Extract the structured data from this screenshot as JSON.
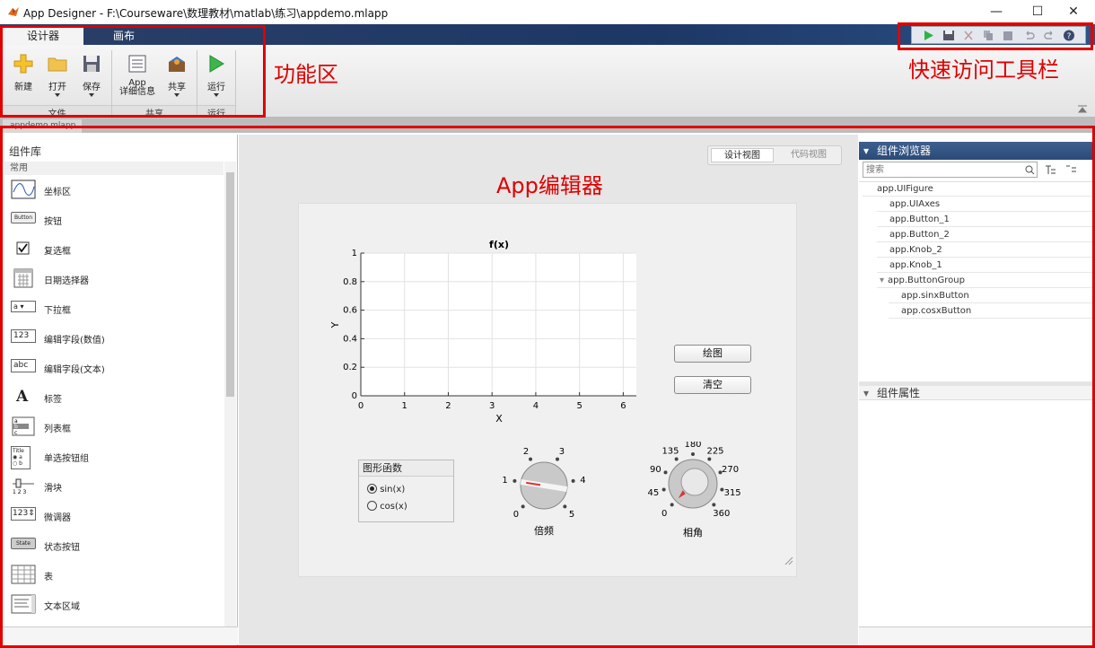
{
  "window": {
    "title": "App Designer - F:\\Courseware\\数理教材\\matlab\\练习\\appdemo.mlapp",
    "minimize_glyph": "—",
    "maximize_glyph": "☐",
    "close_glyph": "✕"
  },
  "ribbon": {
    "tabs": [
      {
        "label": "设计器"
      },
      {
        "label": "画布"
      }
    ],
    "buttons": {
      "new": "新建",
      "open": "打开",
      "save": "保存",
      "app_details_line1": "App",
      "app_details_line2": "详细信息",
      "share": "共享",
      "run": "运行"
    },
    "sections": {
      "file": "文件",
      "share": "共享",
      "run": "运行"
    }
  },
  "doc_tab": {
    "label": "appdemo.mlapp",
    "close": "×"
  },
  "annotations": {
    "ribbon_label": "功能区",
    "qat_label": "快速访问工具栏",
    "editor_label": "App编辑器"
  },
  "library": {
    "title": "组件库",
    "section": "常用",
    "items": [
      {
        "label": "坐标区",
        "icon": "axes-icon"
      },
      {
        "label": "按钮",
        "icon": "button-icon",
        "icon_text": "Button"
      },
      {
        "label": "复选框",
        "icon": "checkbox-icon"
      },
      {
        "label": "日期选择器",
        "icon": "calendar-icon"
      },
      {
        "label": "下拉框",
        "icon": "dropdown-icon",
        "icon_text": "a"
      },
      {
        "label": "编辑字段(数值)",
        "icon": "numeric-field-icon",
        "icon_text": "123"
      },
      {
        "label": "编辑字段(文本)",
        "icon": "text-field-icon",
        "icon_text": "abc"
      },
      {
        "label": "标签",
        "icon": "label-icon",
        "icon_text": "A"
      },
      {
        "label": "列表框",
        "icon": "listbox-icon"
      },
      {
        "label": "单选按钮组",
        "icon": "radio-group-icon",
        "icon_text": "Title"
      },
      {
        "label": "滑块",
        "icon": "slider-icon"
      },
      {
        "label": "微调器",
        "icon": "spinner-icon",
        "icon_text": "123"
      },
      {
        "label": "状态按钮",
        "icon": "state-button-icon",
        "icon_text": "State"
      },
      {
        "label": "表",
        "icon": "table-icon"
      },
      {
        "label": "文本区域",
        "icon": "text-area-icon"
      }
    ]
  },
  "view_toggle": {
    "design": "设计视图",
    "code": "代码视图"
  },
  "canvas": {
    "axes_title": "f(x)",
    "xlabel": "X",
    "ylabel": "Y",
    "xticks": [
      "0",
      "1",
      "2",
      "3",
      "4",
      "5",
      "6"
    ],
    "yticks": [
      "0",
      "0.2",
      "0.4",
      "0.6",
      "0.8",
      "1"
    ],
    "plot_button": "绘图",
    "clear_button": "清空",
    "button_group_title": "图形函数",
    "radio_sin": "sin(x)",
    "radio_cos": "cos(x)",
    "radio_selected": "sin(x)",
    "knob_freq_label": "倍频",
    "knob_freq_ticks": [
      "0",
      "1",
      "2",
      "3",
      "4",
      "5"
    ],
    "knob_freq_value": 1,
    "knob_phase_label": "相角",
    "knob_phase_ticks": [
      "0",
      "45",
      "90",
      "135",
      "180",
      "225",
      "270",
      "315",
      "360"
    ],
    "knob_phase_value": 0
  },
  "chart_data": {
    "type": "line",
    "title": "f(x)",
    "xlabel": "X",
    "ylabel": "Y",
    "xlim": [
      0,
      6.3
    ],
    "ylim": [
      0,
      1
    ],
    "x_ticks": [
      0,
      1,
      2,
      3,
      4,
      5,
      6
    ],
    "y_ticks": [
      0,
      0.2,
      0.4,
      0.6,
      0.8,
      1
    ],
    "grid": true,
    "series": []
  },
  "browser": {
    "title": "组件浏览器",
    "search_placeholder": "搜索",
    "items": [
      {
        "label": "app.UIFigure",
        "level": 0
      },
      {
        "label": "app.UIAxes",
        "level": 1
      },
      {
        "label": "app.Button_1",
        "level": 1
      },
      {
        "label": "app.Button_2",
        "level": 1
      },
      {
        "label": "app.Knob_2",
        "level": 1
      },
      {
        "label": "app.Knob_1",
        "level": 1
      },
      {
        "label": "app.ButtonGroup",
        "level": 1
      },
      {
        "label": "app.sinxButton",
        "level": 2
      },
      {
        "label": "app.cosxButton",
        "level": 2
      }
    ],
    "props_title": "组件属性"
  },
  "colors": {
    "annotation_red": "#e00000",
    "ribbon_blue": "#1d3766",
    "tree_line": "#e6e6e6"
  }
}
